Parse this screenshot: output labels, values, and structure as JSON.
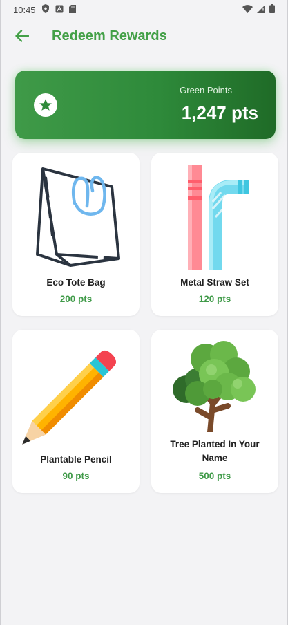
{
  "status_bar": {
    "time": "10:45"
  },
  "header": {
    "title": "Redeem Rewards"
  },
  "points": {
    "label": "Green Points",
    "value": "1,247 pts"
  },
  "rewards": [
    {
      "name": "Eco Tote Bag",
      "points": "200 pts",
      "icon": "tote-bag-icon"
    },
    {
      "name": "Metal Straw Set",
      "points": "120 pts",
      "icon": "straw-icon"
    },
    {
      "name": "Plantable Pencil",
      "points": "90 pts",
      "icon": "pencil-icon"
    },
    {
      "name": "Tree Planted In Your Name",
      "points": "500 pts",
      "icon": "tree-icon"
    }
  ],
  "colors": {
    "accent": "#43a047",
    "card_gradient_start": "#3f9a48",
    "card_gradient_end": "#1f6b27",
    "background": "#f3f3f5"
  }
}
